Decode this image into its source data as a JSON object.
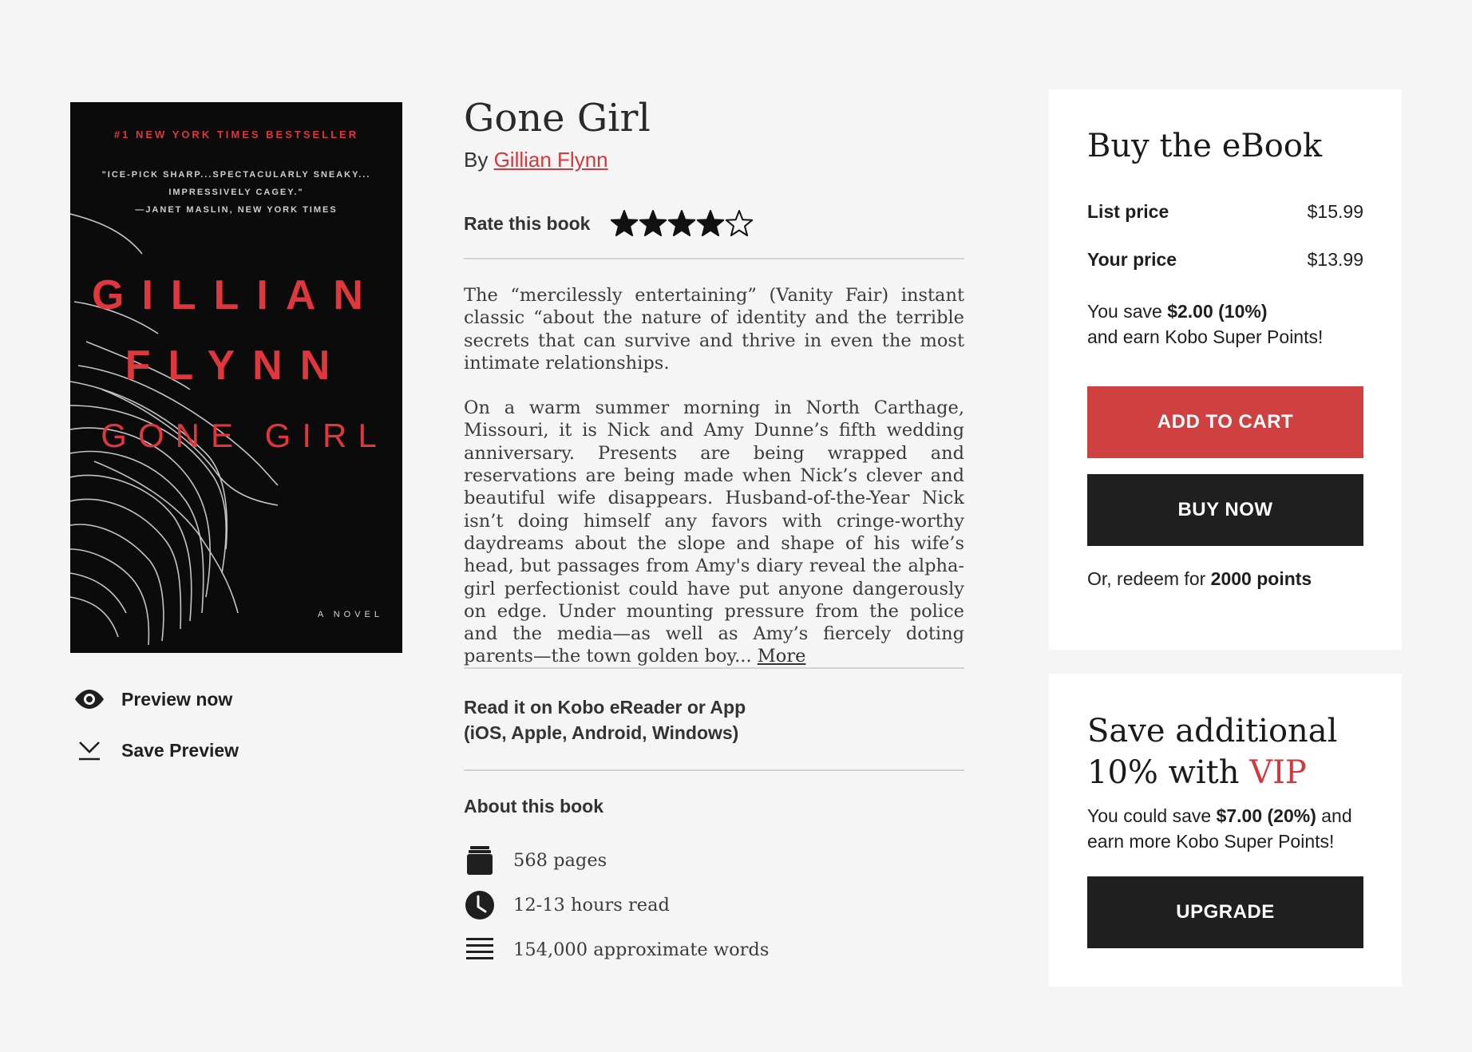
{
  "cover": {
    "banner": "#1 NEW YORK TIMES BESTSELLER",
    "quote_line1": "\"ICE-PICK SHARP...SPECTACULARLY SNEAKY...",
    "quote_line2": "IMPRESSIVELY CAGEY.\"",
    "quote_line3": "—JANET MASLIN, NEW YORK TIMES",
    "author_first": "GILLIAN",
    "author_last": "FLYNN",
    "title": "GONE GIRL",
    "subtitle": "A NOVEL"
  },
  "preview": {
    "preview_label": "Preview now",
    "save_label": "Save Preview"
  },
  "book": {
    "title": "Gone Girl",
    "by_label": "By",
    "author": "Gillian Flynn",
    "rate_label": "Rate this book",
    "rating": 4,
    "rating_max": 5,
    "description_p1": "The “mercilessly entertaining” (Vanity Fair) instant classic “about the nature of identity and the terrible secrets that can survive and thrive in even the most intimate relationships.",
    "description_p2": "On a warm summer morning in North Carthage, Missouri, it is Nick and Amy Dunne’s fifth wedding anniversary. Presents are being wrapped and reservations are being made when Nick’s clever and beautiful wife disappears. Husband-of-the-Year Nick isn’t doing himself any favors with cringe-worthy daydreams about the slope and shape of his wife’s head, but passages from Amy's diary reveal the alpha-girl perfectionist could have put anyone dangerously on edge. Under mounting pressure from the police and the media—as well as Amy’s fiercely doting parents—the town golden boy...",
    "more_label": "More",
    "read_on_line1": "Read it on Kobo eReader or App",
    "read_on_line2": "(iOS, Apple, Android, Windows)",
    "about_heading": "About this book",
    "pages": "568 pages",
    "hours": "12-13 hours read",
    "words": "154,000 approximate words"
  },
  "buy_panel": {
    "heading": "Buy the eBook",
    "list_price_label": "List price",
    "list_price": "$15.99",
    "your_price_label": "Your price",
    "your_price": "$13.99",
    "save_prefix": "You save",
    "save_amount": "$2.00 (10%)",
    "save_suffix": "and earn Kobo Super Points!",
    "add_to_cart_label": "ADD TO CART",
    "buy_now_label": "BUY NOW",
    "redeem_prefix": "Or, redeem for",
    "redeem_points": "2000 points"
  },
  "vip_panel": {
    "heading_line1": "Save additional",
    "heading_line2_prefix": "10% with",
    "heading_vip": "VIP",
    "text_prefix": "You could save",
    "save_amount": "$7.00 (20%)",
    "text_suffix": "and earn more Kobo Super Points!",
    "upgrade_label": "UPGRADE"
  },
  "colors": {
    "accent_red": "#cf4040",
    "dark_button": "#1f1f1f",
    "background": "#f5f5f5",
    "panel": "#ffffff"
  },
  "icons": {
    "preview": "eye-icon",
    "save": "download-icon",
    "pages": "book-stack-icon",
    "hours": "clock-icon",
    "words": "lines-icon",
    "star_filled": "star-filled-icon",
    "star_empty": "star-empty-icon"
  }
}
